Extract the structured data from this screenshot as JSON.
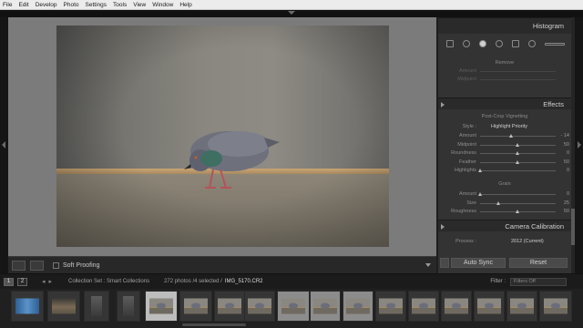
{
  "menu": [
    "File",
    "Edit",
    "Develop",
    "Photo",
    "Settings",
    "Tools",
    "View",
    "Window",
    "Help"
  ],
  "toolbar": {
    "soft_proofing_label": "Soft Proofing"
  },
  "panel": {
    "histogram_title": "Histogram",
    "vignette_sub": "Remove",
    "vignette_rows": [
      {
        "label": "Amount",
        "value": ""
      },
      {
        "label": "Midpoint",
        "value": ""
      }
    ],
    "effects_title": "Effects",
    "post_crop_sub": "Post-Crop Vignetting",
    "style_label": "Style :",
    "style_value": "Highlight Priority",
    "effects_rows": [
      {
        "label": "Amount",
        "value": "- 14",
        "pos": 0.42
      },
      {
        "label": "Midpoint",
        "value": "50",
        "pos": 0.5
      },
      {
        "label": "Roundness",
        "value": "0",
        "pos": 0.5
      },
      {
        "label": "Feather",
        "value": "50",
        "pos": 0.5
      },
      {
        "label": "Highlights",
        "value": "0",
        "pos": 0.0
      }
    ],
    "grain_sub": "Grain",
    "grain_rows": [
      {
        "label": "Amount",
        "value": "0",
        "pos": 0.0
      },
      {
        "label": "Size",
        "value": "25",
        "pos": 0.25
      },
      {
        "label": "Roughness",
        "value": "50",
        "pos": 0.5
      }
    ],
    "camera_title": "Camera Calibration",
    "process_label": "Process :",
    "process_value": "2012 (Current)",
    "auto_sync_label": "Auto Sync",
    "reset_label": "Reset"
  },
  "filmstrip_bar": {
    "page1": "1",
    "page2": "2",
    "collection": "Collection Set : Smart Collections",
    "count": "272 photos /4 selected /",
    "filename": "IMG_5170.CR2",
    "filter_label": "Filter :",
    "filter_value": "Filters Off"
  },
  "colors": {
    "menu_bg": "#ececec",
    "panel_bg": "#333333",
    "canvas_bg": "#7b7b7b"
  }
}
